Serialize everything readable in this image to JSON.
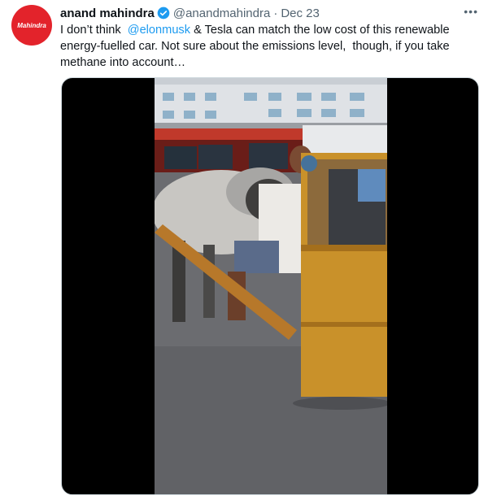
{
  "tweet": {
    "avatar_text": "Mahindra",
    "author_name": "anand mahindra",
    "handle": "@anandmahindra",
    "separator": "·",
    "date": "Dec 23",
    "more_icon": "more-dots-icon",
    "text_before": "I don’t think  ",
    "mention": "@elonmusk",
    "text_after": " & Tesla can match the low cost of this renewable energy-fuelled car. Not sure about the emissions level,  though, if you take methane into account…"
  },
  "media": {
    "type": "video"
  },
  "colors": {
    "link": "#1d9bf0",
    "secondary_text": "#536471",
    "brand_red": "#e3232b"
  }
}
